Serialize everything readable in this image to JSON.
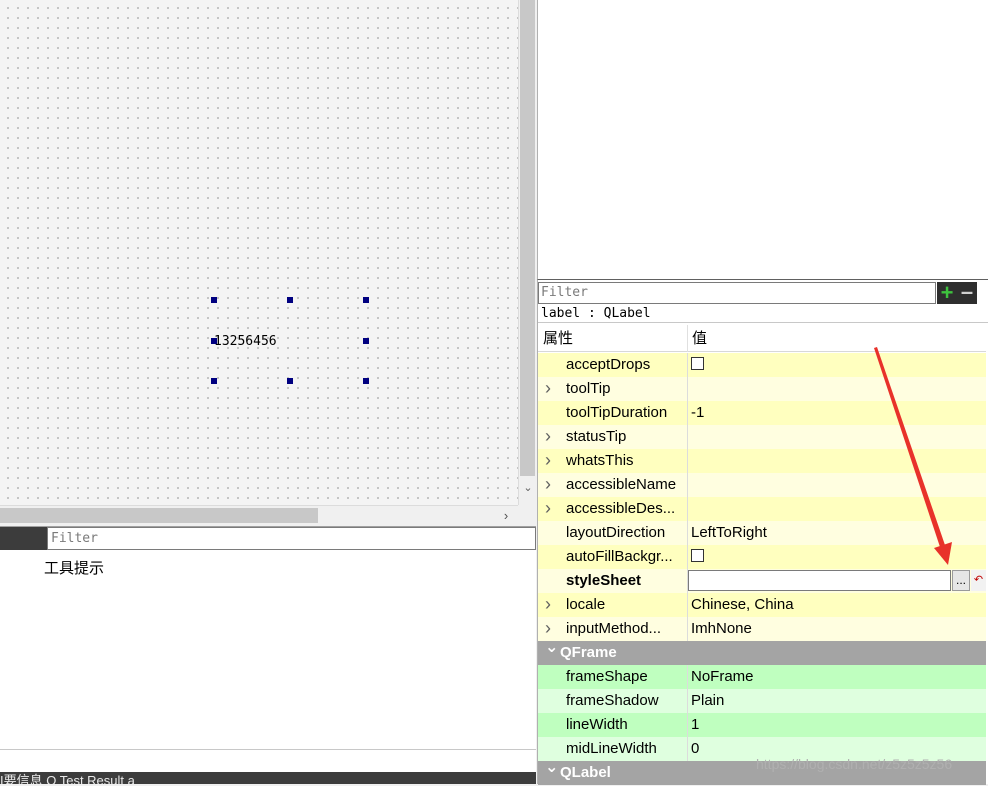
{
  "form": {
    "label_text": "13256456"
  },
  "action_editor": {
    "filter_placeholder": "Filter",
    "items": [
      "工具提示"
    ]
  },
  "status_bar": {
    "text": "I要信息   Q Test Result  a"
  },
  "property_editor": {
    "filter_placeholder": "Filter",
    "object_class": "label : QLabel",
    "header": {
      "property": "属性",
      "value": "值"
    },
    "rows": [
      {
        "name": "acceptDrops",
        "value": "",
        "checkbox": true,
        "expandable": false,
        "tone": "y1"
      },
      {
        "name": "toolTip",
        "value": "",
        "expandable": true,
        "tone": "y2"
      },
      {
        "name": "toolTipDuration",
        "value": "-1",
        "expandable": false,
        "tone": "y1"
      },
      {
        "name": "statusTip",
        "value": "",
        "expandable": true,
        "tone": "y2"
      },
      {
        "name": "whatsThis",
        "value": "",
        "expandable": true,
        "tone": "y1"
      },
      {
        "name": "accessibleName",
        "value": "",
        "expandable": true,
        "tone": "y2"
      },
      {
        "name": "accessibleDes...",
        "value": "",
        "expandable": true,
        "tone": "y1"
      },
      {
        "name": "layoutDirection",
        "value": "LeftToRight",
        "expandable": false,
        "tone": "y2"
      },
      {
        "name": "autoFillBackgr...",
        "value": "",
        "checkbox": true,
        "expandable": false,
        "tone": "y1"
      },
      {
        "name": "styleSheet",
        "value": "",
        "expandable": false,
        "tone": "y2",
        "bold": true,
        "stylesheet": true,
        "browse_label": "..."
      },
      {
        "name": "locale",
        "value": "Chinese, China",
        "expandable": true,
        "tone": "y1"
      },
      {
        "name": "inputMethod...",
        "value": "ImhNone",
        "expandable": true,
        "tone": "y2"
      }
    ],
    "groups": [
      {
        "name": "QFrame",
        "rows": [
          {
            "name": "frameShape",
            "value": "NoFrame",
            "tone": "g1"
          },
          {
            "name": "frameShadow",
            "value": "Plain",
            "tone": "g2"
          },
          {
            "name": "lineWidth",
            "value": "1",
            "tone": "g1"
          },
          {
            "name": "midLineWidth",
            "value": "0",
            "tone": "g2"
          }
        ]
      },
      {
        "name": "QLabel",
        "rows": []
      }
    ]
  },
  "watermark": "https://blog.csdn.net/z5z5z5z56",
  "annotation_color": "#e8322a",
  "colors": {
    "selection_handle": "#000080",
    "group_header": "#a4a4a4",
    "qwidget_row": "#ffffbf",
    "qframe_row": "#bfffbf"
  }
}
